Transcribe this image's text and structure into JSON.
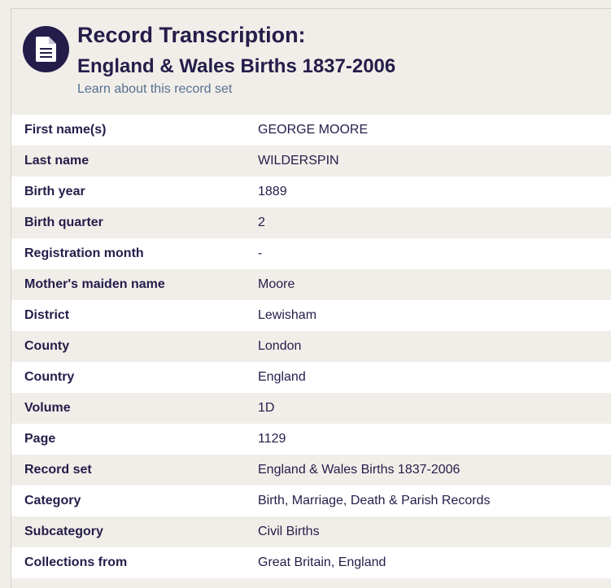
{
  "header": {
    "title": "Record Transcription:",
    "subtitle": "England & Wales Births 1837-2006",
    "link": "Learn about this record set",
    "icon": "document-icon"
  },
  "colors": {
    "navy": "#241d4a",
    "link": "#56708f",
    "row_alt": "#f1eee9",
    "row_white": "#ffffff"
  },
  "rows": [
    {
      "label": "First name(s)",
      "value": "GEORGE MOORE"
    },
    {
      "label": "Last name",
      "value": "WILDERSPIN"
    },
    {
      "label": "Birth year",
      "value": "1889"
    },
    {
      "label": "Birth quarter",
      "value": "2"
    },
    {
      "label": "Registration month",
      "value": "-"
    },
    {
      "label": "Mother's maiden name",
      "value": "Moore"
    },
    {
      "label": "District",
      "value": "Lewisham"
    },
    {
      "label": "County",
      "value": "London"
    },
    {
      "label": "Country",
      "value": "England"
    },
    {
      "label": "Volume",
      "value": "1D"
    },
    {
      "label": "Page",
      "value": "1129"
    },
    {
      "label": "Record set",
      "value": "England & Wales Births 1837-2006"
    },
    {
      "label": "Category",
      "value": "Birth, Marriage, Death & Parish Records"
    },
    {
      "label": "Subcategory",
      "value": "Civil Births"
    },
    {
      "label": "Collections from",
      "value": "Great Britain, England"
    }
  ]
}
